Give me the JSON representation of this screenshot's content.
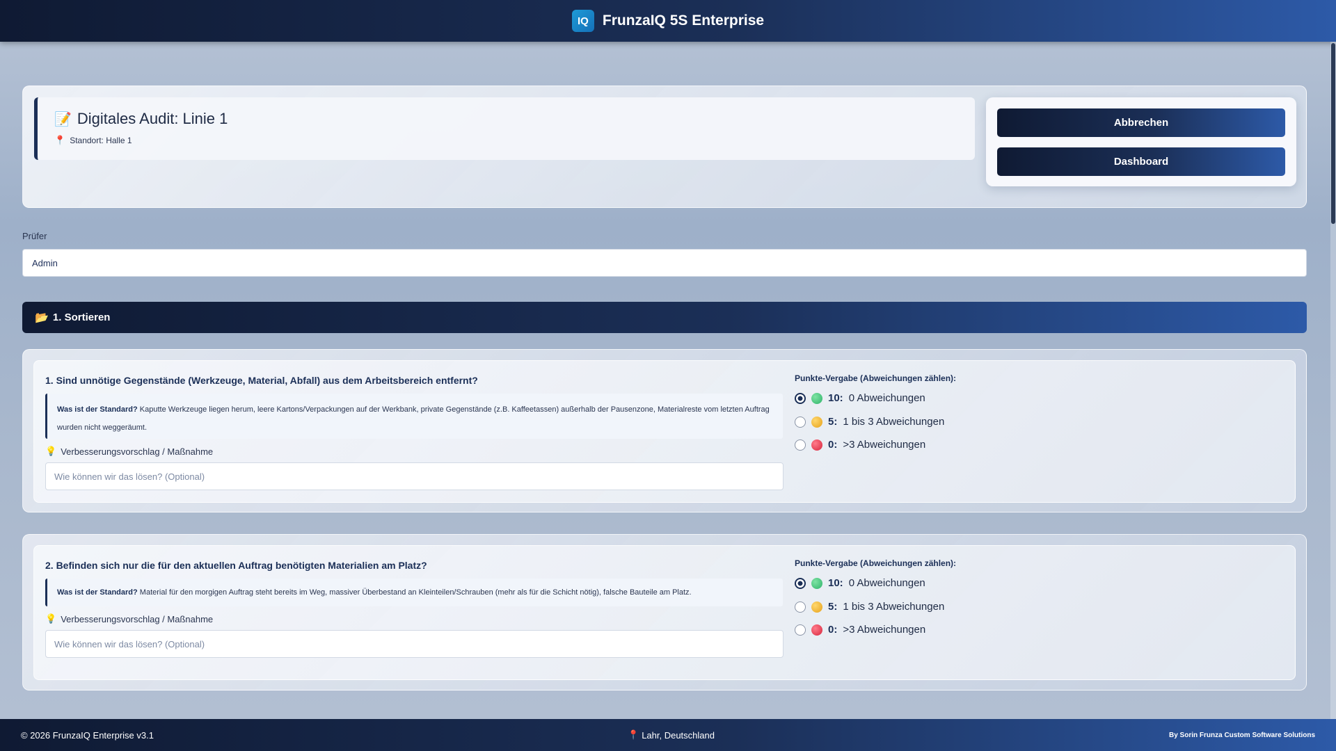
{
  "app": {
    "logo_text": "IQ",
    "title": "FrunzaIQ 5S Enterprise"
  },
  "audit": {
    "icon": "memo-icon",
    "title": "Digitales Audit: Linie 1",
    "location": "Standort: Halle 1"
  },
  "actions": {
    "cancel_label": "Abbrechen",
    "dashboard_label": "Dashboard"
  },
  "pruefer": {
    "label": "Prüfer",
    "value": "Admin"
  },
  "section": {
    "title": "1. Sortieren"
  },
  "questions": [
    {
      "title": "1. Sind unnötige Gegenstände (Werkzeuge, Material, Abfall) aus dem Arbeitsbereich entfernt?",
      "standard_label": "Was ist der Standard?",
      "standard_text": "Kaputte Werkzeuge liegen herum, leere Kartons/Verpackungen auf der Werkbank, private Gegenstände (z.B. Kaffeetassen) außerhalb der Pausenzone, Materialreste vom letzten Auftrag wurden nicht weggeräumt.",
      "improvement_label": "Verbesserungsvorschlag / Maßnahme",
      "improvement_placeholder": "Wie können wir das lösen? (Optional)",
      "score_label": "Punkte-Vergabe (Abweichungen zählen):",
      "options": [
        {
          "points": "10:",
          "text": "0 Abweichungen",
          "selected": true,
          "color": "#2fb36a"
        },
        {
          "points": "5:",
          "text": "1 bis 3 Abweichungen",
          "selected": false,
          "color": "#e6a21a"
        },
        {
          "points": "0:",
          "text": ">3 Abweichungen",
          "selected": false,
          "color": "#d7263d"
        }
      ]
    },
    {
      "title": "2. Befinden sich nur die für den aktuellen Auftrag benötigten Materialien am Platz?",
      "standard_label": "Was ist der Standard?",
      "standard_text": "Material für den morgigen Auftrag steht bereits im Weg, massiver Überbestand an Kleinteilen/Schrauben (mehr als für die Schicht nötig), falsche Bauteile am Platz.",
      "improvement_label": "Verbesserungsvorschlag / Maßnahme",
      "improvement_placeholder": "Wie können wir das lösen? (Optional)",
      "score_label": "Punkte-Vergabe (Abweichungen zählen):",
      "options": [
        {
          "points": "10:",
          "text": "0 Abweichungen",
          "selected": true,
          "color": "#2fb36a"
        },
        {
          "points": "5:",
          "text": "1 bis 3 Abweichungen",
          "selected": false,
          "color": "#e6a21a"
        },
        {
          "points": "0:",
          "text": ">3 Abweichungen",
          "selected": false,
          "color": "#d7263d"
        }
      ]
    }
  ],
  "footer": {
    "copyright": "© 2026 FrunzaIQ Enterprise v3.1",
    "location": "Lahr, Deutschland",
    "credit": "By Sorin Frunza Custom Software Solutions"
  }
}
